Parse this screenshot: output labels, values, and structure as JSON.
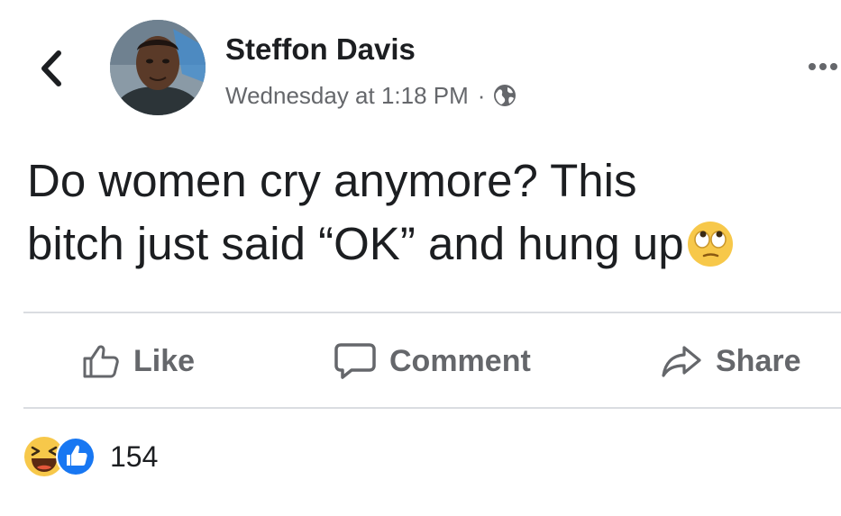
{
  "post": {
    "author": "Steffon Davis",
    "timestamp": "Wednesday at 1:18 PM",
    "separator": "·",
    "privacy_icon": "globe-icon",
    "text_line_1": "Do women cry anymore? This",
    "text_line_2": "bitch just said “OK” and hung up",
    "emoji": "eye-roll-emoji"
  },
  "actions": {
    "like_label": "Like",
    "comment_label": "Comment",
    "share_label": "Share"
  },
  "reactions": {
    "icons": [
      "haha-icon",
      "like-icon"
    ],
    "count": "154"
  },
  "colors": {
    "text": "#1c1e21",
    "secondary_text": "#65676b",
    "divider": "#dadde1",
    "like_blue": "#1877f2",
    "haha_yellow": "#f7c84a"
  }
}
